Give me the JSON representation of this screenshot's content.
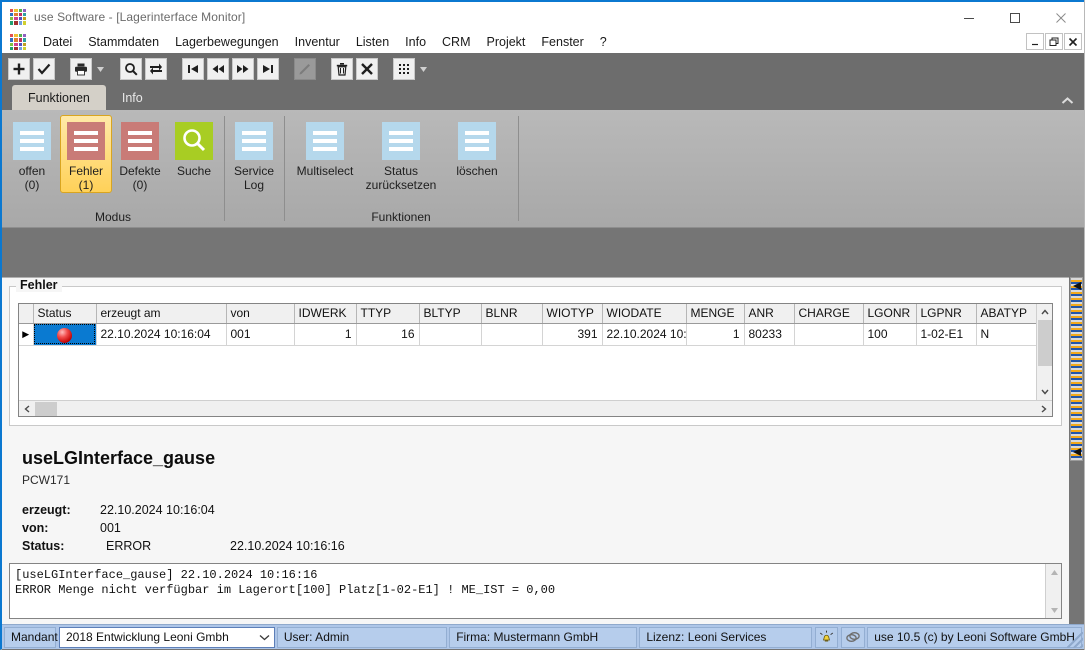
{
  "window": {
    "title": "use Software - [Lagerinterface Monitor]",
    "minimize": "minimize-icon",
    "maximize": "maximize-icon",
    "close": "close-icon"
  },
  "menubar": {
    "items": [
      "Datei",
      "Stammdaten",
      "Lagerbewegungen",
      "Inventur",
      "Listen",
      "Info",
      "CRM",
      "Projekt",
      "Fenster",
      "?"
    ]
  },
  "mdi_child": {
    "title": "Lagerinterface Monitor",
    "restore_label": "_",
    "maximize_label": "❐",
    "close_label": "✕"
  },
  "quick_access": {
    "buttons": [
      {
        "name": "new-icon",
        "glyph": "+",
        "disabled": false
      },
      {
        "name": "confirm-check-icon",
        "glyph": "✓",
        "disabled": false
      },
      {
        "name": "print-icon",
        "glyph": "print",
        "disabled": false
      },
      {
        "name": "print-dropdown-caret",
        "glyph": "▼",
        "disabled": false
      },
      {
        "name": "search-icon",
        "glyph": "⚲",
        "disabled": false
      },
      {
        "name": "refresh-icon",
        "glyph": "⇄",
        "disabled": false
      },
      {
        "name": "first-record-icon",
        "glyph": "|◀",
        "disabled": false
      },
      {
        "name": "previous-record-icon",
        "glyph": "◀◀",
        "disabled": false
      },
      {
        "name": "next-record-icon",
        "glyph": "▶▶",
        "disabled": false
      },
      {
        "name": "last-record-icon",
        "glyph": "▶|",
        "disabled": false
      },
      {
        "name": "edit-pencil-icon",
        "glyph": "✎",
        "disabled": true
      },
      {
        "name": "delete-trash-icon",
        "glyph": "trash",
        "disabled": false
      },
      {
        "name": "cancel-x-icon",
        "glyph": "✕",
        "disabled": false
      },
      {
        "name": "grid-view-icon",
        "glyph": "grid",
        "disabled": false
      },
      {
        "name": "grid-dropdown-caret",
        "glyph": "▼",
        "disabled": false
      }
    ]
  },
  "ribbon": {
    "tabs": [
      {
        "label": "Funktionen",
        "active": true
      },
      {
        "label": "Info",
        "active": false
      }
    ],
    "collapse_icon": "chevron-up-icon",
    "groups": [
      {
        "name": "modus",
        "label": "Modus",
        "buttons": [
          {
            "name": "offen",
            "line1": "offen",
            "line2": "(0)",
            "icon": "lines-icon",
            "color": "blue",
            "selected": false
          },
          {
            "name": "fehler",
            "line1": "Fehler",
            "line2": "(1)",
            "icon": "lines-icon",
            "color": "red",
            "selected": true
          },
          {
            "name": "defekte",
            "line1": "Defekte",
            "line2": "(0)",
            "icon": "lines-icon",
            "color": "red",
            "selected": false
          },
          {
            "name": "suche",
            "line1": "Suche",
            "line2": "",
            "icon": "magnifier-icon",
            "color": "green",
            "selected": false
          }
        ]
      },
      {
        "name": "service-log",
        "label": "",
        "buttons": [
          {
            "name": "service-log",
            "line1": "Service",
            "line2": "Log",
            "icon": "lines-icon",
            "color": "blue",
            "selected": false
          }
        ]
      },
      {
        "name": "funktionen",
        "label": "Funktionen",
        "buttons": [
          {
            "name": "multiselect",
            "line1": "Multiselect",
            "line2": "",
            "icon": "lines-icon",
            "color": "blue",
            "selected": false
          },
          {
            "name": "status-zuruecksetzen",
            "line1": "Status",
            "line2": "zurücksetzen",
            "icon": "lines-icon",
            "color": "blue",
            "selected": false
          },
          {
            "name": "loeschen",
            "line1": "löschen",
            "line2": "",
            "icon": "lines-icon",
            "color": "blue",
            "selected": false
          }
        ]
      }
    ]
  },
  "errors_panel": {
    "title": "Fehler",
    "columns": [
      "Status",
      "erzeugt am",
      "von",
      "IDWERK",
      "TTYP",
      "BLTYP",
      "BLNR",
      "WIOTYP",
      "WIODATE",
      "MENGE",
      "ANR",
      "CHARGE",
      "LGONR",
      "LGPNR",
      "ABATYP"
    ],
    "rows": [
      {
        "selected": true,
        "indicator": "▶",
        "status_icon": "red-error-ball-icon",
        "erzeugt_am": "22.10.2024 10:16:04",
        "von": "001",
        "idwerk": "1",
        "ttyp": "16",
        "bltyp": "",
        "blnr": "",
        "wiotyp": "391",
        "wiodate": "22.10.2024 10:",
        "menge": "1",
        "anr": "80233",
        "charge": "",
        "lgonr": "100",
        "lgpnr": "1-02-E1",
        "abatyp": "N"
      }
    ]
  },
  "detail": {
    "heading": "useLGInterface_gause",
    "subheading": "PCW171",
    "fields": [
      {
        "key": "erzeugt:",
        "value": "22.10.2024 10:16:04",
        "extra": ""
      },
      {
        "key": "von:",
        "value": "001",
        "extra": ""
      },
      {
        "key": "Status:",
        "value": "ERROR",
        "extra": "22.10.2024 10:16:16"
      }
    ]
  },
  "log": {
    "text": "[useLGInterface_gause] 22.10.2024 10:16:16\nERROR Menge nicht verfügbar im Lagerort[100] Platz[1-02-E1] ! ME_IST = 0,00"
  },
  "statusbar": {
    "mandant_label": "Mandant",
    "mandant_value": "2018  Entwicklung Leoni Gmbh",
    "user": "User: Admin",
    "firma": "Firma: Mustermann GmbH",
    "lizenz": "Lizenz: Leoni Services",
    "notify_icon": "bell-alert-icon",
    "link_icon": "chain-link-icon",
    "version": "use 10.5 (c) by Leoni Software GmbH"
  },
  "colors": {
    "accent": "#0b78d0",
    "selection": "#0a7ad1",
    "ribbon_selected": "#ffd158",
    "error": "#c00000",
    "statusbar": "#aec6e8"
  }
}
